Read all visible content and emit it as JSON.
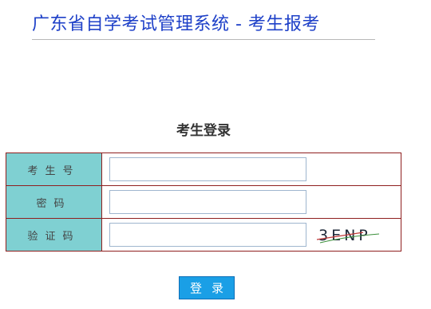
{
  "header": {
    "title": "广东省自学考试管理系统 - 考生报考"
  },
  "login": {
    "heading": "考生登录",
    "fields": [
      {
        "label": "考生号",
        "value": "",
        "placeholder": ""
      },
      {
        "label": "密码",
        "value": "",
        "placeholder": ""
      },
      {
        "label": "验证码",
        "value": "",
        "placeholder": ""
      }
    ],
    "captcha": {
      "text": "3ENP"
    },
    "submit_label": "登录"
  },
  "colors": {
    "title": "#1e40c8",
    "label_bg": "#7fd0d2",
    "table_border": "#8f1f1f",
    "button_bg": "#1a9fe6"
  }
}
